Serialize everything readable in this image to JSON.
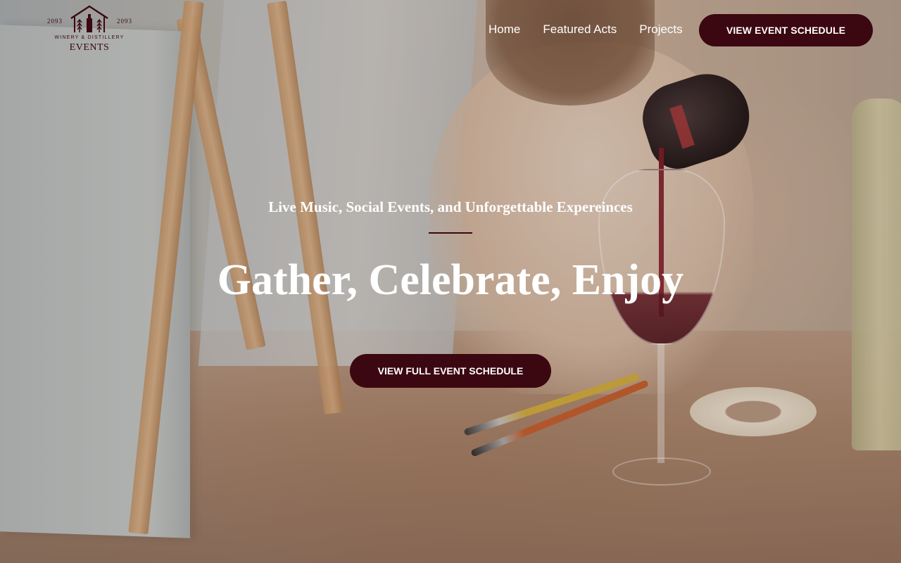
{
  "logo": {
    "year_left": "2093",
    "year_right": "2093",
    "tagline": "WINERY & DISTILLERY",
    "name": "EVENTS",
    "icon": "winery-barn-icon"
  },
  "nav": {
    "items": [
      {
        "label": "Home"
      },
      {
        "label": "Featured Acts"
      },
      {
        "label": "Projects"
      }
    ],
    "cta_label": "VIEW EVENT SCHEDULE"
  },
  "hero": {
    "subtitle": "Live Music, Social Events, and Unforgettable Expereinces",
    "title": "Gather, Celebrate, Enjoy",
    "cta_label": "VIEW FULL EVENT SCHEDULE",
    "background": "photo of wine being poured into a glass at a painting class"
  },
  "colors": {
    "brand": "#3b0710",
    "text_on_dark": "#ffffff"
  }
}
